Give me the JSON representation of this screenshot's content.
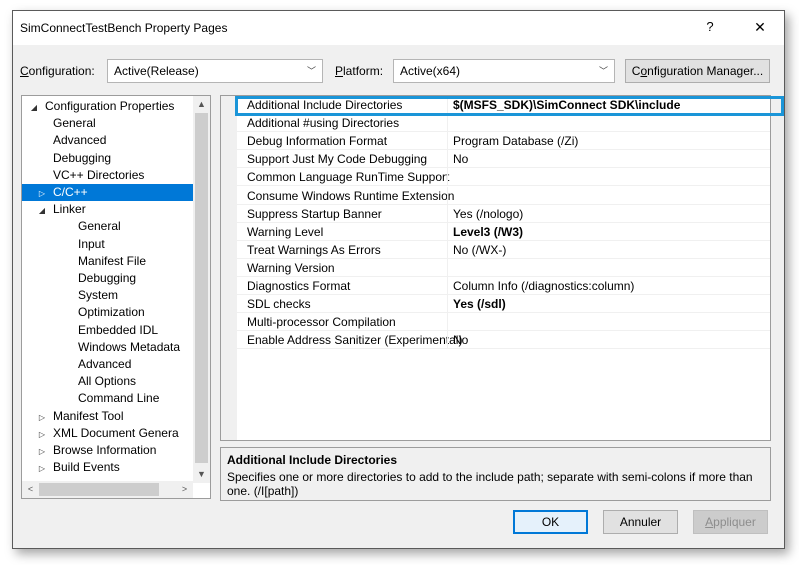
{
  "window": {
    "title": "SimConnectTestBench Property Pages",
    "help_label": "?",
    "close_label": "✕"
  },
  "config": {
    "configuration_label_u": "C",
    "configuration_label_rest": "onfiguration:",
    "configuration_value": "Active(Release)",
    "platform_label_u": "P",
    "platform_label_rest": "latform:",
    "platform_value": "Active(x64)",
    "manager_label_u": "o",
    "manager_label_pre": "C",
    "manager_label_rest": "nfiguration Manager..."
  },
  "tree": {
    "items": [
      {
        "label": "Configuration Properties",
        "toggle": "◢",
        "indent": 0
      },
      {
        "label": "General",
        "toggle": "",
        "indent": 1
      },
      {
        "label": "Advanced",
        "toggle": "",
        "indent": 1
      },
      {
        "label": "Debugging",
        "toggle": "",
        "indent": 1
      },
      {
        "label": "VC++ Directories",
        "toggle": "",
        "indent": 1
      },
      {
        "label": "C/C++",
        "toggle": "▷",
        "indent": 1,
        "selected": true
      },
      {
        "label": "Linker",
        "toggle": "◢",
        "indent": 1
      },
      {
        "label": "General",
        "toggle": "",
        "indent": 2
      },
      {
        "label": "Input",
        "toggle": "",
        "indent": 2
      },
      {
        "label": "Manifest File",
        "toggle": "",
        "indent": 2
      },
      {
        "label": "Debugging",
        "toggle": "",
        "indent": 2
      },
      {
        "label": "System",
        "toggle": "",
        "indent": 2
      },
      {
        "label": "Optimization",
        "toggle": "",
        "indent": 2
      },
      {
        "label": "Embedded IDL",
        "toggle": "",
        "indent": 2
      },
      {
        "label": "Windows Metadata",
        "toggle": "",
        "indent": 2
      },
      {
        "label": "Advanced",
        "toggle": "",
        "indent": 2
      },
      {
        "label": "All Options",
        "toggle": "",
        "indent": 2
      },
      {
        "label": "Command Line",
        "toggle": "",
        "indent": 2
      },
      {
        "label": "Manifest Tool",
        "toggle": "▷",
        "indent": 1
      },
      {
        "label": "XML Document Genera",
        "toggle": "▷",
        "indent": 1
      },
      {
        "label": "Browse Information",
        "toggle": "▷",
        "indent": 1
      },
      {
        "label": "Build Events",
        "toggle": "▷",
        "indent": 1
      }
    ],
    "scroll_up": "▲",
    "scroll_down": "▼",
    "scroll_left": "<",
    "scroll_right": ">"
  },
  "properties": [
    {
      "name": "Additional Include Directories",
      "value": "$(MSFS_SDK)\\SimConnect SDK\\include",
      "bold": true
    },
    {
      "name": "Additional #using Directories",
      "value": "",
      "bold": false
    },
    {
      "name": "Debug Information Format",
      "value": "Program Database (/Zi)",
      "bold": false
    },
    {
      "name": "Support Just My Code Debugging",
      "value": "No",
      "bold": false
    },
    {
      "name": "Common Language RunTime Support",
      "value": "",
      "bold": false
    },
    {
      "name": "Consume Windows Runtime Extension",
      "value": "",
      "bold": false
    },
    {
      "name": "Suppress Startup Banner",
      "value": "Yes (/nologo)",
      "bold": false
    },
    {
      "name": "Warning Level",
      "value": "Level3 (/W3)",
      "bold": true
    },
    {
      "name": "Treat Warnings As Errors",
      "value": "No (/WX-)",
      "bold": false
    },
    {
      "name": "Warning Version",
      "value": "",
      "bold": false
    },
    {
      "name": "Diagnostics Format",
      "value": "Column Info (/diagnostics:column)",
      "bold": false
    },
    {
      "name": "SDL checks",
      "value": "Yes (/sdl)",
      "bold": true
    },
    {
      "name": "Multi-processor Compilation",
      "value": "",
      "bold": false
    },
    {
      "name": "Enable Address Sanitizer (Experimental)",
      "value": "No",
      "bold": false
    }
  ],
  "description": {
    "title": "Additional Include Directories",
    "body": "Specifies one or more directories to add to the include path; separate with semi-colons if more than one. (/I[path])"
  },
  "footer": {
    "ok_label": "OK",
    "cancel_label": "Annuler",
    "apply_label_u": "A",
    "apply_label_rest": "ppliquer"
  },
  "colors": {
    "selection": "#0078d7",
    "highlight_box": "#1a95d8"
  }
}
